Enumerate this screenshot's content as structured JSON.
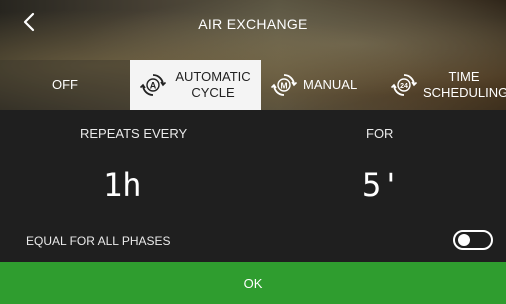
{
  "header": {
    "title": "AIR EXCHANGE"
  },
  "tabs": [
    {
      "label": "OFF"
    },
    {
      "label": "AUTOMATIC CYCLE",
      "icon": "automatic-cycle-icon",
      "icon_text": "A"
    },
    {
      "label": "MANUAL",
      "icon": "manual-icon",
      "icon_text": "M"
    },
    {
      "label": "TIME SCHEDULING",
      "icon": "time-scheduling-icon",
      "icon_text": "24"
    }
  ],
  "settings": {
    "repeats_label": "REPEATS EVERY",
    "repeats_value": "1h",
    "for_label": "FOR",
    "for_value": "5'",
    "equal_label": "EQUAL FOR ALL PHASES",
    "equal_enabled": false
  },
  "actions": {
    "ok_label": "OK"
  },
  "colors": {
    "ok_bg": "#2f9d2f",
    "active_tab_bg": "#f4f4f4",
    "panel_bg": "#1f1f1f"
  }
}
